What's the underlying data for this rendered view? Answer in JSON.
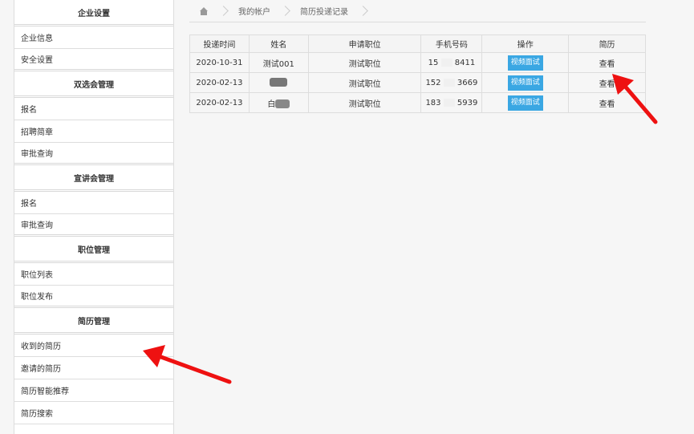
{
  "sidebar": {
    "sections": [
      {
        "title": "企业设置",
        "items": [
          "企业信息",
          "安全设置"
        ]
      },
      {
        "title": "双选会管理",
        "items": [
          "报名",
          "招聘简章",
          "审批查询"
        ]
      },
      {
        "title": "宣讲会管理",
        "items": [
          "报名",
          "审批查询"
        ]
      },
      {
        "title": "职位管理",
        "items": [
          "职位列表",
          "职位发布"
        ]
      },
      {
        "title": "简历管理",
        "items": [
          "收到的简历",
          "邀请的简历",
          "简历智能推荐",
          "简历搜索"
        ]
      }
    ]
  },
  "breadcrumb": {
    "home_icon": "home-icon",
    "items": [
      "我的帐户",
      "简历投递记录"
    ]
  },
  "table": {
    "headers": [
      "投递时间",
      "姓名",
      "申请职位",
      "手机号码",
      "操作",
      "简历"
    ],
    "rows": [
      {
        "date": "2020-10-31",
        "name": "测试001",
        "position": "测试职位",
        "phone_a": "15",
        "phone_b": "8411",
        "action": "视频面试",
        "resume": "查看"
      },
      {
        "date": "2020-02-13",
        "name": "",
        "position": "测试职位",
        "phone_a": "152",
        "phone_b": "3669",
        "action": "视频面试",
        "resume": "查看"
      },
      {
        "date": "2020-02-13",
        "name": "白",
        "position": "测试职位",
        "phone_a": "183",
        "phone_b": "5939",
        "action": "视频面试",
        "resume": "查看"
      }
    ]
  },
  "colors": {
    "accent": "#3aa7e3",
    "arrow": "#ee1111"
  }
}
